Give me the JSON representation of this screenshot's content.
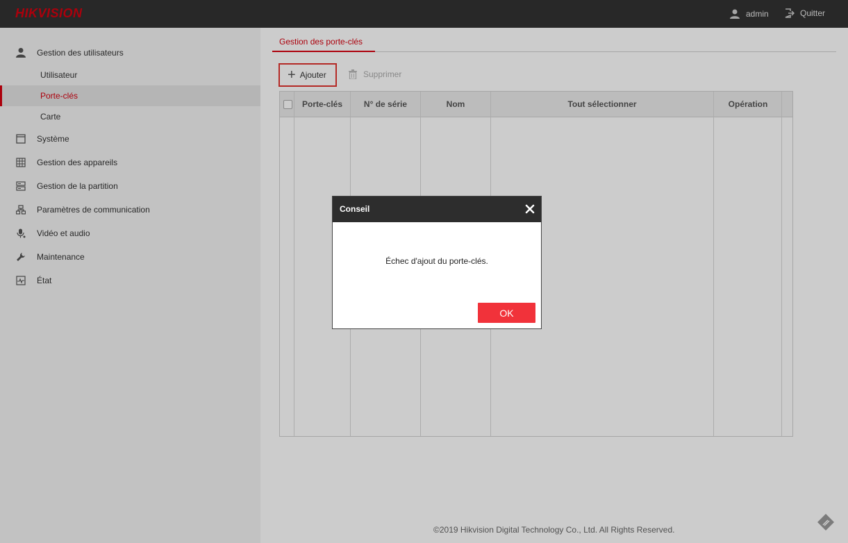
{
  "app": {
    "brand": "HIKVISION",
    "user_label": "admin",
    "logout_label": "Quitter"
  },
  "sidebar": {
    "groups": [
      {
        "label": "Gestion des utilisateurs",
        "icon": "user-icon"
      },
      {
        "label": "Système",
        "icon": "window-icon"
      },
      {
        "label": "Gestion des appareils",
        "icon": "grid-icon"
      },
      {
        "label": "Gestion de la partition",
        "icon": "server-icon"
      },
      {
        "label": "Paramètres de communication",
        "icon": "network-icon"
      },
      {
        "label": "Vidéo et audio",
        "icon": "microphone-icon"
      },
      {
        "label": "Maintenance",
        "icon": "wrench-icon"
      },
      {
        "label": "État",
        "icon": "pulse-icon"
      }
    ],
    "sub_items": [
      {
        "label": "Utilisateur",
        "active": false
      },
      {
        "label": "Porte-clés",
        "active": true
      },
      {
        "label": "Carte",
        "active": false
      }
    ]
  },
  "main": {
    "tab_label": "Gestion des porte-clés",
    "toolbar": {
      "add_label": "Ajouter",
      "delete_label": "Supprimer"
    },
    "table": {
      "columns": [
        "Porte-clés",
        "N° de série",
        "Nom",
        "Tout sélectionner",
        "Opération"
      ],
      "rows": []
    }
  },
  "footer": {
    "copyright": "©2019 Hikvision Digital Technology Co., Ltd. All Rights Reserved."
  },
  "dialog": {
    "title": "Conseil",
    "message": "Échec d'ajout du porte-clés.",
    "ok_label": "OK"
  },
  "colors": {
    "accent": "#d7000f",
    "ok_button": "#f1323a",
    "topbar": "#333333"
  }
}
